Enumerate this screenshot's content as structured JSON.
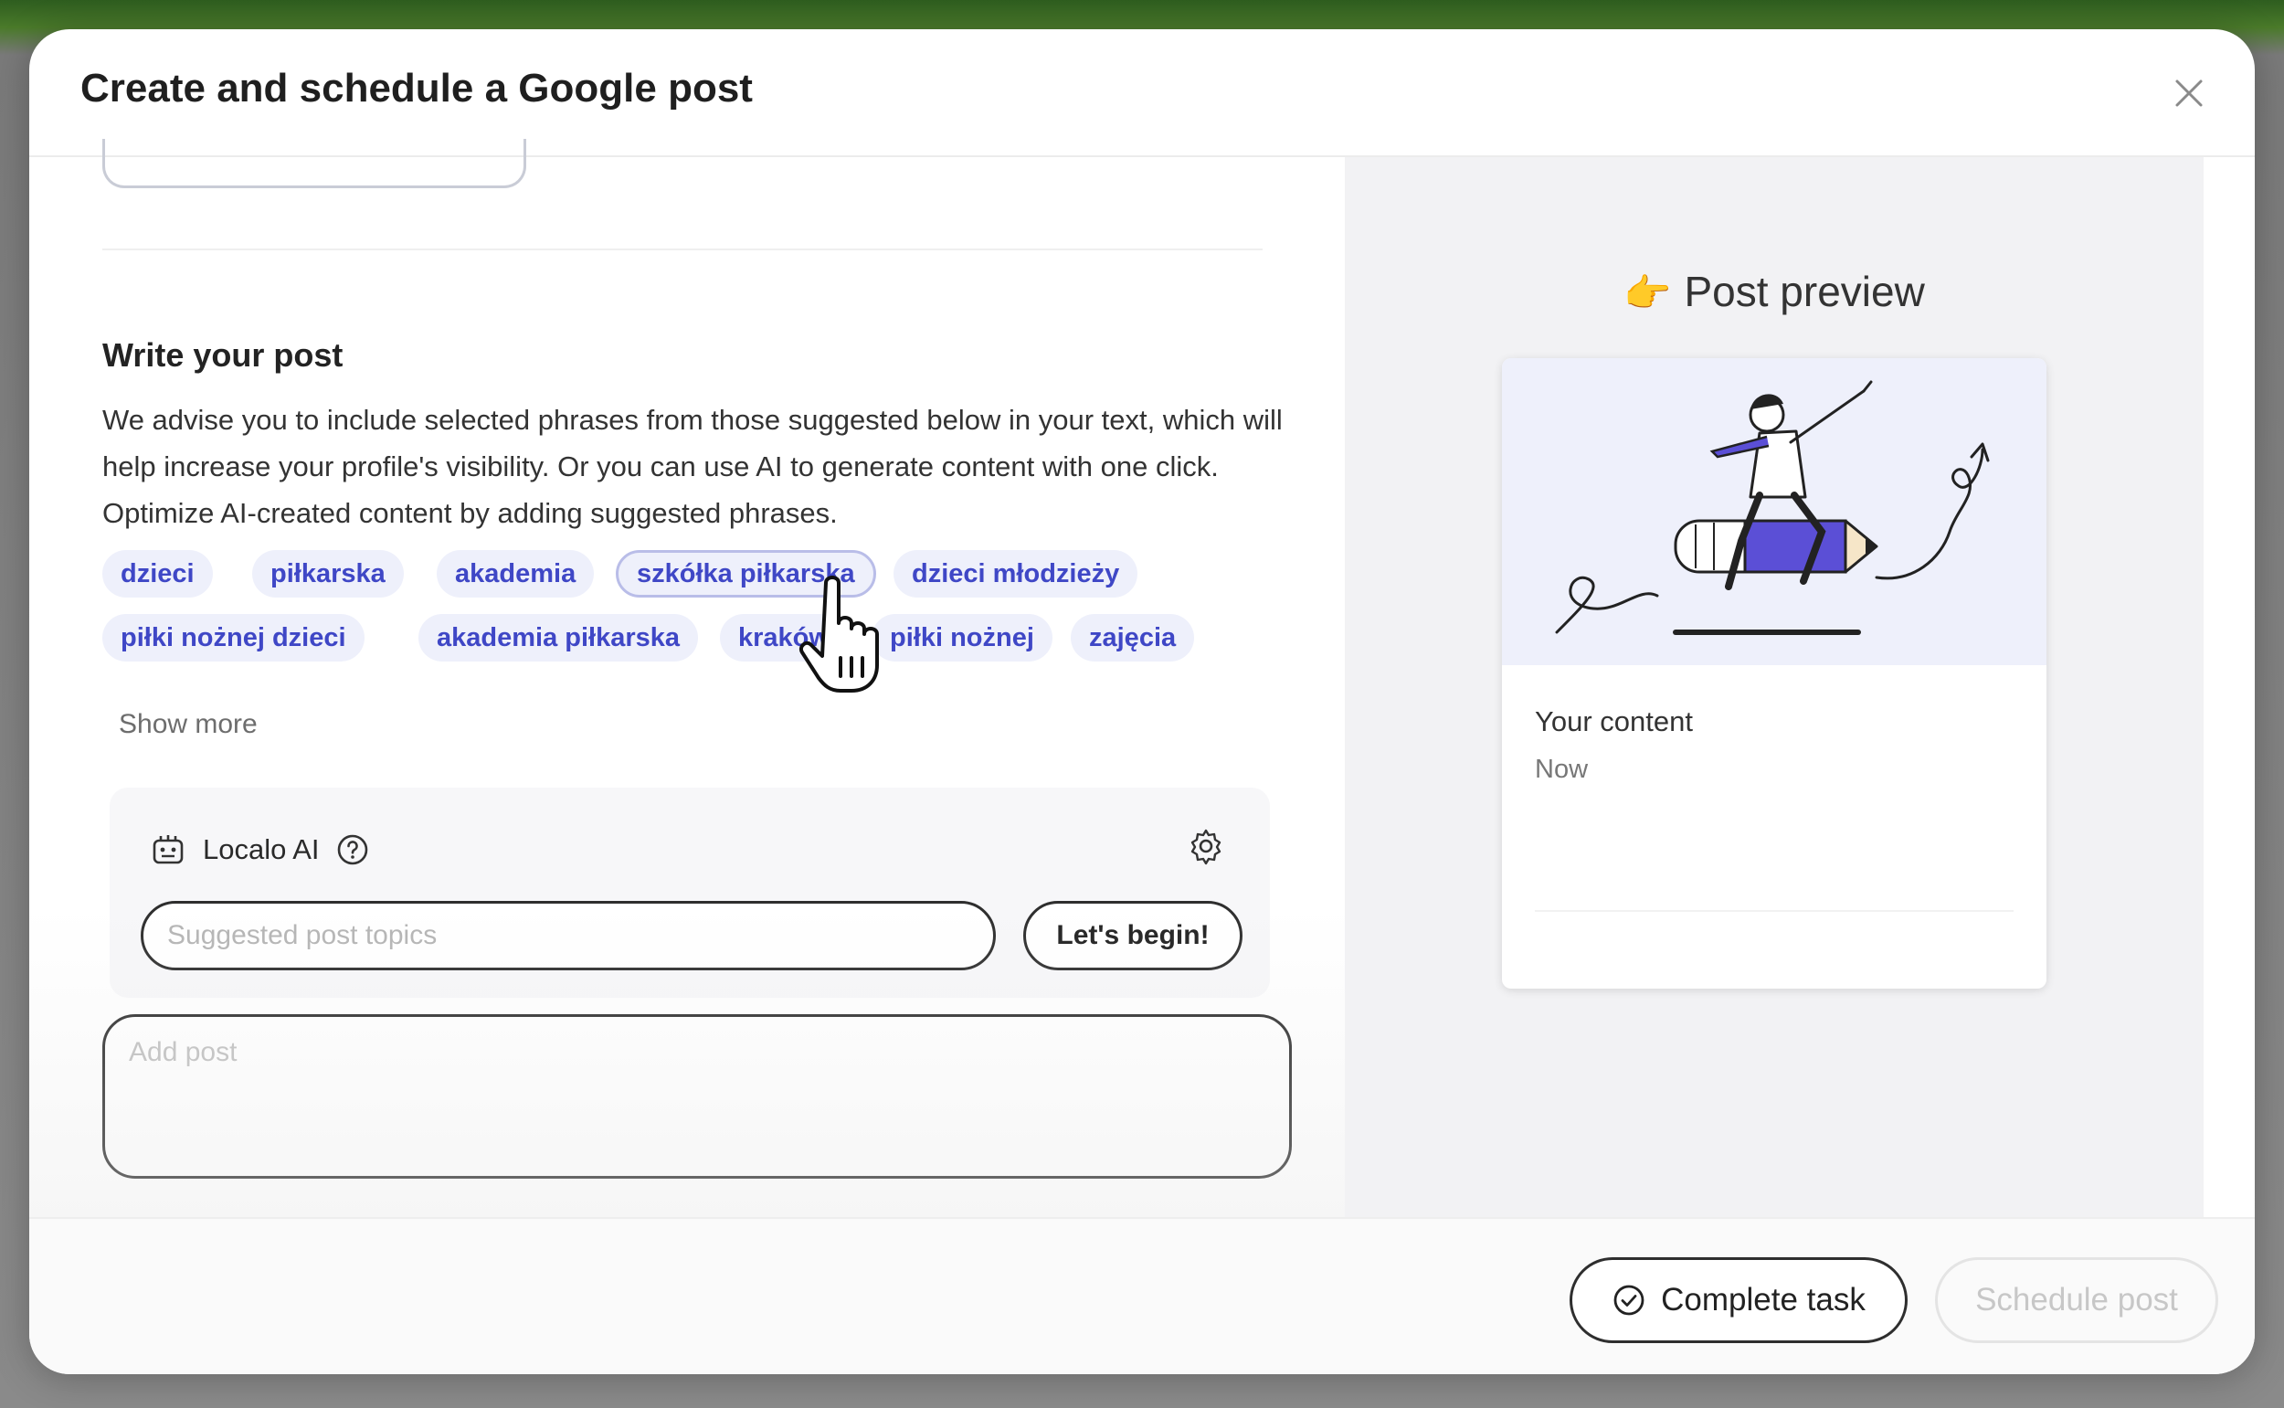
{
  "modal": {
    "title": "Create and schedule a Google post"
  },
  "write": {
    "title": "Write your post",
    "description": "We advise you to include selected phrases from those suggested below in your text, which will help increase your profile's visibility. Or you can use AI to generate content with one click. Optimize AI-created content by adding suggested phrases.",
    "chips": [
      "dzieci",
      "piłkarska",
      "akademia",
      "szkółka piłkarska",
      "dzieci młodzieży",
      "piłki nożnej dzieci",
      "akademia piłkarska",
      "kraków",
      "piłki nożnej",
      "zajęcia"
    ],
    "show_more": "Show more"
  },
  "ai": {
    "label": "Localo AI",
    "topics_placeholder": "Suggested post topics",
    "begin_label": "Let's begin!"
  },
  "post": {
    "placeholder": "Add post"
  },
  "preview": {
    "title": "Post preview",
    "content": "Your content",
    "time": "Now"
  },
  "footer": {
    "complete_label": "Complete task",
    "schedule_label": "Schedule post"
  },
  "colors": {
    "chip_text": "#3f47c6",
    "chip_bg": "#eef0fb",
    "accent_purple": "#5b4fd6"
  }
}
